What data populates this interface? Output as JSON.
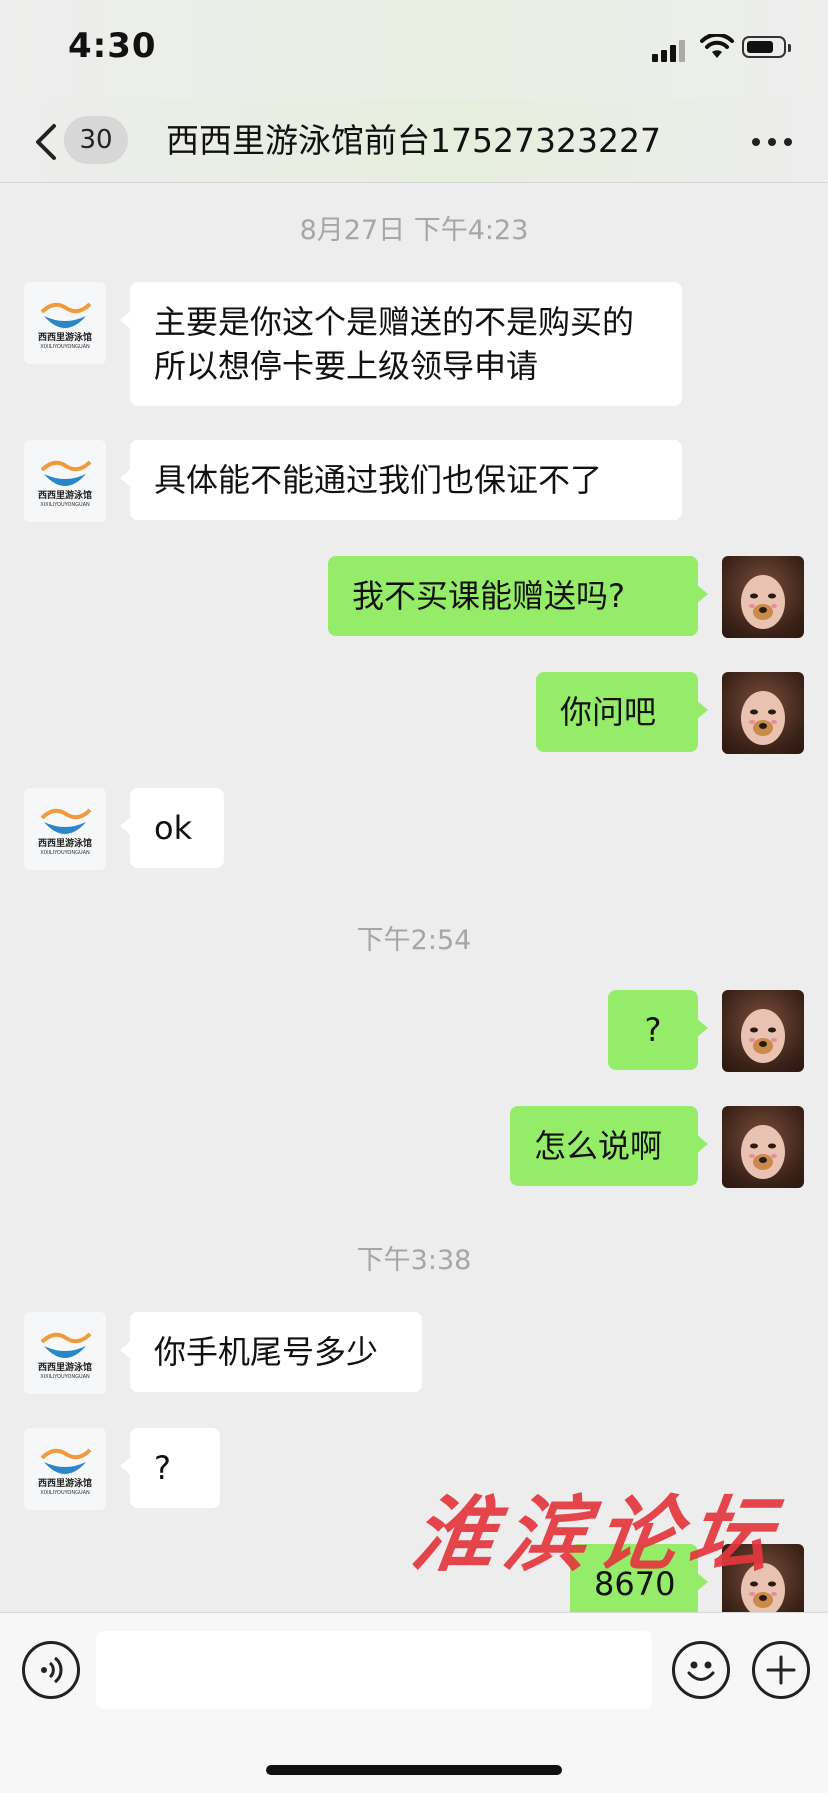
{
  "status_bar": {
    "time": "4:30"
  },
  "header": {
    "unread_count": "30",
    "title": "西西里游泳馆前台17527323227",
    "back_icon": "chevron-left-icon",
    "more_icon": "ellipsis-icon"
  },
  "timestamps": [
    "8月27日 下午4:23",
    "下午2:54",
    "下午3:38"
  ],
  "contact": {
    "avatar_logo_text": "西西里游泳馆",
    "avatar_logo_subtext": "XIXILIYOUYONGUAN"
  },
  "messages": [
    {
      "side": "left",
      "text": "主要是你这个是赠送的不是购买的  所以想停卡要上级领导申请"
    },
    {
      "side": "left",
      "text": "具体能不能通过我们也保证不了"
    },
    {
      "side": "right",
      "text": "我不买课能赠送吗?"
    },
    {
      "side": "right",
      "text": "你问吧"
    },
    {
      "side": "left",
      "text": "ok"
    },
    {
      "side": "right",
      "text": "?"
    },
    {
      "side": "right",
      "text": "怎么说啊"
    },
    {
      "side": "left",
      "text": "你手机尾号多少"
    },
    {
      "side": "left",
      "text": "?"
    },
    {
      "side": "right",
      "text": "8670"
    }
  ],
  "watermark": "淮滨论坛",
  "input_bar": {
    "voice_icon": "voice-icon",
    "emoji_icon": "emoji-icon",
    "plus_icon": "plus-icon",
    "text_value": ""
  },
  "colors": {
    "sent_bubble": "#95ec69",
    "received_bubble": "#ffffff",
    "background": "#ededed",
    "watermark": "#e4373d"
  }
}
